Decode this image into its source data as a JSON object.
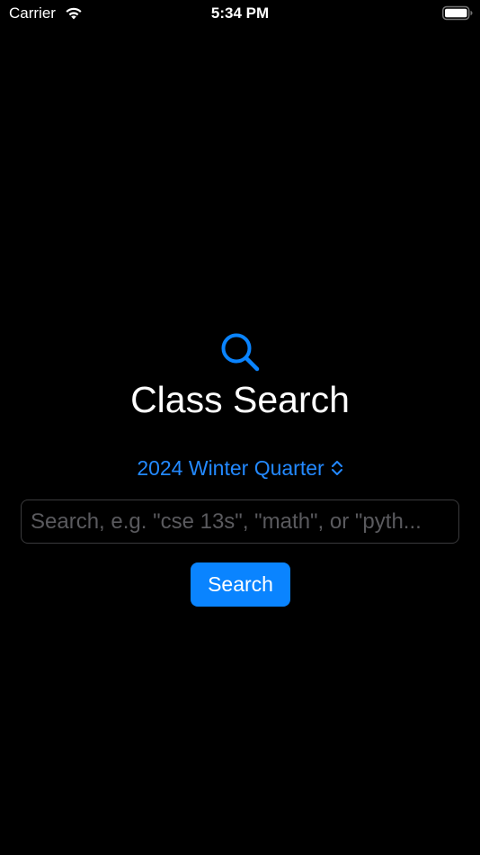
{
  "status_bar": {
    "carrier": "Carrier",
    "time": "5:34 PM",
    "wifi_icon": "wifi-icon",
    "battery_icon": "battery-full-icon"
  },
  "hero": {
    "icon": "magnifying-glass-icon",
    "title": "Class Search"
  },
  "term_picker": {
    "selected": "2024 Winter Quarter",
    "icon": "chevron-up-down-icon"
  },
  "search": {
    "value": "",
    "placeholder": "Search, e.g. \"cse 13s\", \"math\", or \"pyth...",
    "button_label": "Search"
  },
  "colors": {
    "background": "#000000",
    "accent": "#0a84ff",
    "text": "#ffffff",
    "placeholder": "#5a5a5e"
  }
}
